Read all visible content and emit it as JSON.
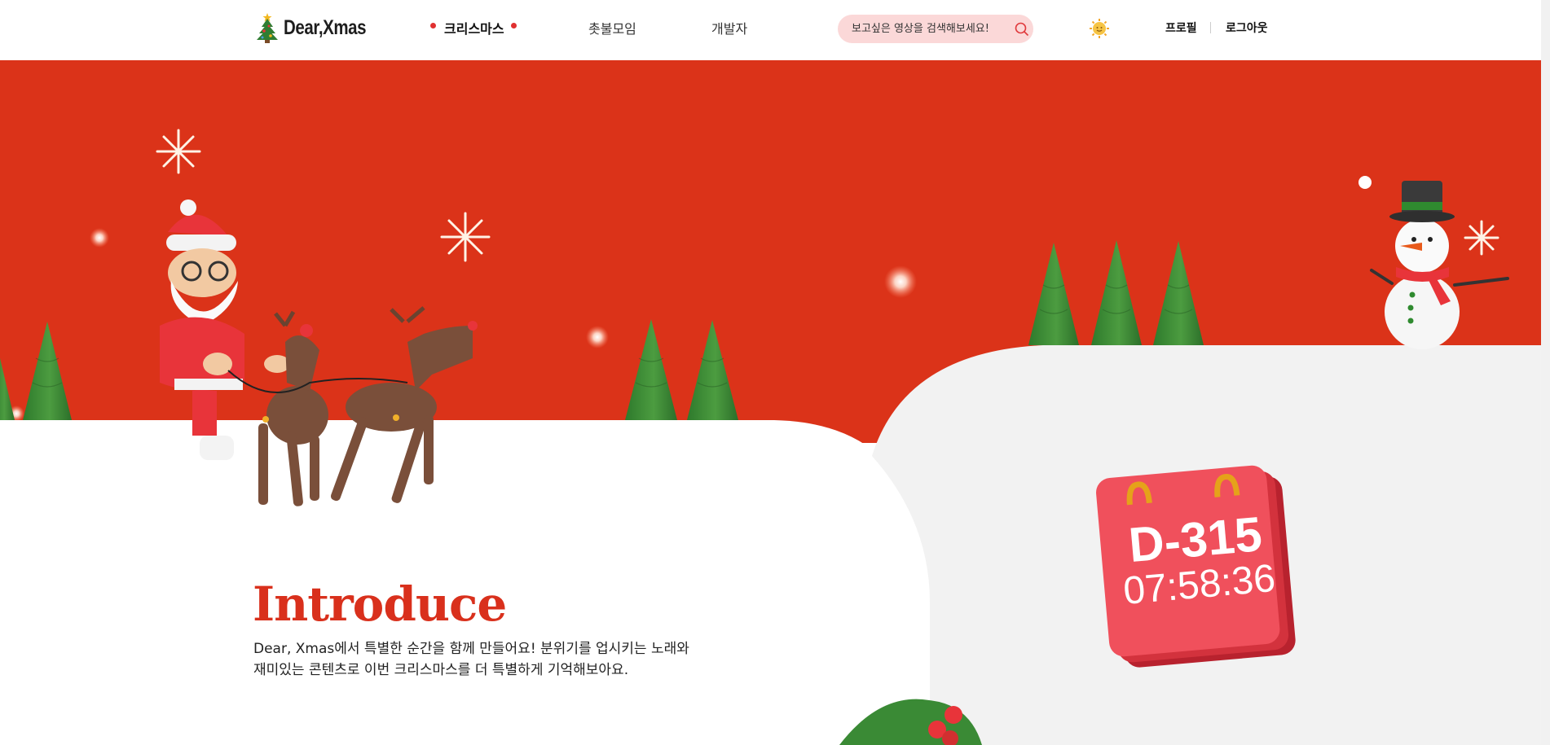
{
  "header": {
    "logo_text": "Dear,Xmas",
    "nav": [
      {
        "label": "크리스마스",
        "active": true
      },
      {
        "label": "촛불모임",
        "active": false
      },
      {
        "label": "개발자",
        "active": false
      }
    ],
    "search_placeholder": "보고싶은 영상을 검색해보세요!",
    "theme_icon": "sun-icon",
    "user_links": [
      "프로필",
      "로그아웃"
    ]
  },
  "hero": {
    "intro_title": "Introduce",
    "intro_line1": "Dear, Xmas에서 특별한 순간을 함께 만들어요! 분위기를 업시키는 노래와",
    "intro_line2": "재미있는 콘텐츠로 이번 크리스마스를 더 특별하게 기억해보아요.",
    "dday": {
      "count": "D-315",
      "time": "07:58:36"
    }
  },
  "colors": {
    "accent_red": "#d9301c",
    "hero_bg": "#db3319",
    "tree_green": "#3a8a35",
    "calendar_red": "#f0505c",
    "search_bg": "#fbd8d8"
  }
}
